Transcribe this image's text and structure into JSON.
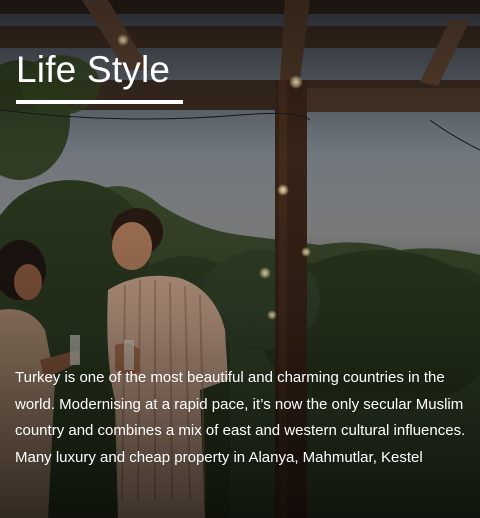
{
  "section": {
    "title": "Life Style",
    "description": "Turkey is one of the most beautiful and charming countries in the world. Modernising at a rapid pace, it’s now the only secular Muslim country and combines a mix of east and western cultural influences. Many luxury and cheap property in Alanya, Mahmutlar, Kestel"
  }
}
